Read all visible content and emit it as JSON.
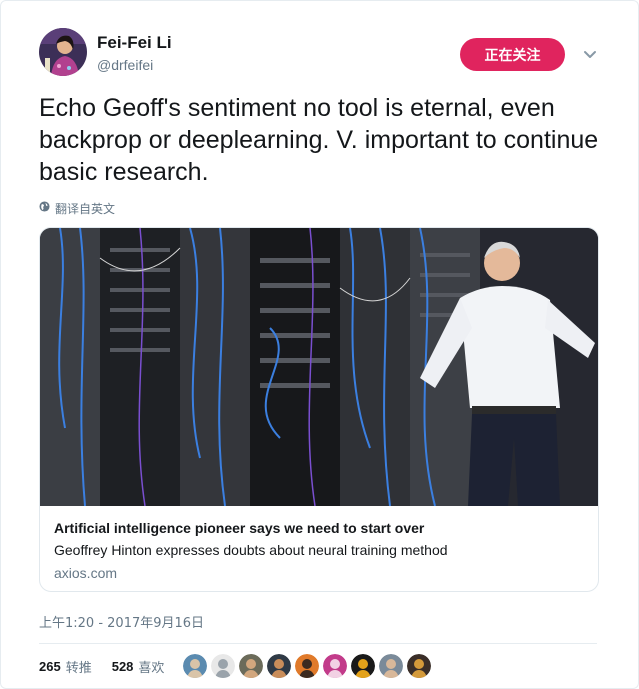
{
  "author": {
    "name": "Fei-Fei Li",
    "handle": "@drfeifei"
  },
  "follow_button": {
    "label": "正在关注"
  },
  "tweet": {
    "text": "Echo Geoff's sentiment no tool is eternal, even backprop or deeplearning. V. important to continue basic research.",
    "translate_label": "翻译自英文"
  },
  "card": {
    "title": "Artificial intelligence pioneer says we need to start over",
    "description": "Geoffrey Hinton expresses doubts about neural training method",
    "domain": "axios.com"
  },
  "meta": {
    "timestamp": "上午1:20 - 2017年9月16日",
    "retweets_count": "265",
    "retweets_label": "转推",
    "likes_count": "528",
    "likes_label": "喜欢"
  },
  "likers": [
    {
      "name": "liker-avatar-1",
      "bg": "#5b8bb0",
      "fg": "#d9c4a8"
    },
    {
      "name": "liker-avatar-2",
      "bg": "#e8e8e8",
      "fg": "#9aa3ab"
    },
    {
      "name": "liker-avatar-3",
      "bg": "#6b6b5a",
      "fg": "#d2a77e"
    },
    {
      "name": "liker-avatar-4",
      "bg": "#2f3a46",
      "fg": "#c98d5a"
    },
    {
      "name": "liker-avatar-5",
      "bg": "#e07a2a",
      "fg": "#3b2a20"
    },
    {
      "name": "liker-avatar-6",
      "bg": "#c23b8a",
      "fg": "#f2d1e4"
    },
    {
      "name": "liker-avatar-7",
      "bg": "#1a1a1a",
      "fg": "#e3a21a"
    },
    {
      "name": "liker-avatar-8",
      "bg": "#7a8a99",
      "fg": "#d8b89a"
    },
    {
      "name": "liker-avatar-9",
      "bg": "#3a2e28",
      "fg": "#d49a3a"
    }
  ],
  "colors": {
    "accent": "#e0245e",
    "secondary_text": "#657786",
    "primary_text": "#14171a",
    "border": "#e1e8ed"
  }
}
